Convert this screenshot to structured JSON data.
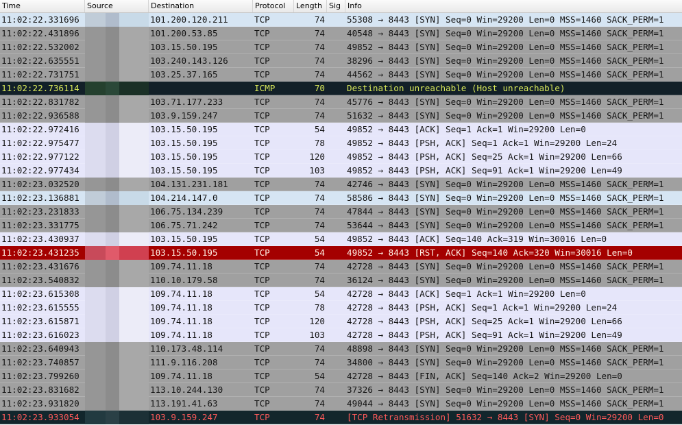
{
  "columns": {
    "time": "Time",
    "source": "Source",
    "destination": "Destination",
    "protocol": "Protocol",
    "length": "Length",
    "sig": "Sig",
    "info": "Info"
  },
  "colors": {
    "gray_row": "#a0a0a0",
    "light_row": "#e6e6fa",
    "selected_row": "#d6e5f3",
    "icmp_row": "#122028",
    "rst_row": "#a40000",
    "retransmission_row": "#12262c"
  },
  "packets": [
    {
      "time": "11:02:22.331696",
      "destination": "101.200.120.211",
      "protocol": "TCP",
      "length": "74",
      "info": "55308 → 8443 [SYN] Seq=0 Win=29200 Len=0 MSS=1460 SACK_PERM=1",
      "style": "sel"
    },
    {
      "time": "11:02:22.431896",
      "destination": "101.200.53.85",
      "protocol": "TCP",
      "length": "74",
      "info": "40548 → 8443 [SYN] Seq=0 Win=29200 Len=0 MSS=1460 SACK_PERM=1",
      "style": "gray"
    },
    {
      "time": "11:02:22.532002",
      "destination": "103.15.50.195",
      "protocol": "TCP",
      "length": "74",
      "info": "49852 → 8443 [SYN] Seq=0 Win=29200 Len=0 MSS=1460 SACK_PERM=1",
      "style": "gray"
    },
    {
      "time": "11:02:22.635551",
      "destination": "103.240.143.126",
      "protocol": "TCP",
      "length": "74",
      "info": "38296 → 8443 [SYN] Seq=0 Win=29200 Len=0 MSS=1460 SACK_PERM=1",
      "style": "gray"
    },
    {
      "time": "11:02:22.731751",
      "destination": "103.25.37.165",
      "protocol": "TCP",
      "length": "74",
      "info": "44562 → 8443 [SYN] Seq=0 Win=29200 Len=0 MSS=1460 SACK_PERM=1",
      "style": "gray"
    },
    {
      "time": "11:02:22.736114",
      "destination": "",
      "protocol": "ICMP",
      "length": "70",
      "info": "Destination unreachable (Host unreachable)",
      "style": "icmp"
    },
    {
      "time": "11:02:22.831782",
      "destination": "103.71.177.233",
      "protocol": "TCP",
      "length": "74",
      "info": "45776 → 8443 [SYN] Seq=0 Win=29200 Len=0 MSS=1460 SACK_PERM=1",
      "style": "gray"
    },
    {
      "time": "11:02:22.936588",
      "destination": "103.9.159.247",
      "protocol": "TCP",
      "length": "74",
      "info": "51632 → 8443 [SYN] Seq=0 Win=29200 Len=0 MSS=1460 SACK_PERM=1",
      "style": "gray"
    },
    {
      "time": "11:02:22.972416",
      "destination": "103.15.50.195",
      "protocol": "TCP",
      "length": "54",
      "info": "49852 → 8443 [ACK] Seq=1 Ack=1 Win=29200 Len=0",
      "style": "light"
    },
    {
      "time": "11:02:22.975477",
      "destination": "103.15.50.195",
      "protocol": "TCP",
      "length": "78",
      "info": "49852 → 8443 [PSH, ACK] Seq=1 Ack=1 Win=29200 Len=24",
      "style": "light"
    },
    {
      "time": "11:02:22.977122",
      "destination": "103.15.50.195",
      "protocol": "TCP",
      "length": "120",
      "info": "49852 → 8443 [PSH, ACK] Seq=25 Ack=1 Win=29200 Len=66",
      "style": "light"
    },
    {
      "time": "11:02:22.977434",
      "destination": "103.15.50.195",
      "protocol": "TCP",
      "length": "103",
      "info": "49852 → 8443 [PSH, ACK] Seq=91 Ack=1 Win=29200 Len=49",
      "style": "light"
    },
    {
      "time": "11:02:23.032520",
      "destination": "104.131.231.181",
      "protocol": "TCP",
      "length": "74",
      "info": "42746 → 8443 [SYN] Seq=0 Win=29200 Len=0 MSS=1460 SACK_PERM=1",
      "style": "gray"
    },
    {
      "time": "11:02:23.136881",
      "destination": "104.214.147.0",
      "protocol": "TCP",
      "length": "74",
      "info": "58586 → 8443 [SYN] Seq=0 Win=29200 Len=0 MSS=1460 SACK_PERM=1",
      "style": "sel"
    },
    {
      "time": "11:02:23.231833",
      "destination": "106.75.134.239",
      "protocol": "TCP",
      "length": "74",
      "info": "47844 → 8443 [SYN] Seq=0 Win=29200 Len=0 MSS=1460 SACK_PERM=1",
      "style": "gray"
    },
    {
      "time": "11:02:23.331775",
      "destination": "106.75.71.242",
      "protocol": "TCP",
      "length": "74",
      "info": "53644 → 8443 [SYN] Seq=0 Win=29200 Len=0 MSS=1460 SACK_PERM=1",
      "style": "gray"
    },
    {
      "time": "11:02:23.430937",
      "destination": "103.15.50.195",
      "protocol": "TCP",
      "length": "54",
      "info": "49852 → 8443 [ACK] Seq=140 Ack=319 Win=30016 Len=0",
      "style": "light"
    },
    {
      "time": "11:02:23.431235",
      "destination": "103.15.50.195",
      "protocol": "TCP",
      "length": "54",
      "info": "49852 → 8443 [RST, ACK] Seq=140 Ack=320 Win=30016 Len=0",
      "style": "rst"
    },
    {
      "time": "11:02:23.431676",
      "destination": "109.74.11.18",
      "protocol": "TCP",
      "length": "74",
      "info": "42728 → 8443 [SYN] Seq=0 Win=29200 Len=0 MSS=1460 SACK_PERM=1",
      "style": "gray"
    },
    {
      "time": "11:02:23.540832",
      "destination": "110.10.179.58",
      "protocol": "TCP",
      "length": "74",
      "info": "36124 → 8443 [SYN] Seq=0 Win=29200 Len=0 MSS=1460 SACK_PERM=1",
      "style": "gray"
    },
    {
      "time": "11:02:23.615308",
      "destination": "109.74.11.18",
      "protocol": "TCP",
      "length": "54",
      "info": "42728 → 8443 [ACK] Seq=1 Ack=1 Win=29200 Len=0",
      "style": "light"
    },
    {
      "time": "11:02:23.615555",
      "destination": "109.74.11.18",
      "protocol": "TCP",
      "length": "78",
      "info": "42728 → 8443 [PSH, ACK] Seq=1 Ack=1 Win=29200 Len=24",
      "style": "light"
    },
    {
      "time": "11:02:23.615871",
      "destination": "109.74.11.18",
      "protocol": "TCP",
      "length": "120",
      "info": "42728 → 8443 [PSH, ACK] Seq=25 Ack=1 Win=29200 Len=66",
      "style": "light"
    },
    {
      "time": "11:02:23.616023",
      "destination": "109.74.11.18",
      "protocol": "TCP",
      "length": "103",
      "info": "42728 → 8443 [PSH, ACK] Seq=91 Ack=1 Win=29200 Len=49",
      "style": "light"
    },
    {
      "time": "11:02:23.640943",
      "destination": "110.173.48.114",
      "protocol": "TCP",
      "length": "74",
      "info": "48898 → 8443 [SYN] Seq=0 Win=29200 Len=0 MSS=1460 SACK_PERM=1",
      "style": "gray"
    },
    {
      "time": "11:02:23.740857",
      "destination": "111.9.116.208",
      "protocol": "TCP",
      "length": "74",
      "info": "34800 → 8443 [SYN] Seq=0 Win=29200 Len=0 MSS=1460 SACK_PERM=1",
      "style": "gray"
    },
    {
      "time": "11:02:23.799260",
      "destination": "109.74.11.18",
      "protocol": "TCP",
      "length": "54",
      "info": "42728 → 8443 [FIN, ACK] Seq=140 Ack=2 Win=29200 Len=0",
      "style": "gray"
    },
    {
      "time": "11:02:23.831682",
      "destination": "113.10.244.130",
      "protocol": "TCP",
      "length": "74",
      "info": "37326 → 8443 [SYN] Seq=0 Win=29200 Len=0 MSS=1460 SACK_PERM=1",
      "style": "gray"
    },
    {
      "time": "11:02:23.931820",
      "destination": "113.191.41.63",
      "protocol": "TCP",
      "length": "74",
      "info": "49044 → 8443 [SYN] Seq=0 Win=29200 Len=0 MSS=1460 SACK_PERM=1",
      "style": "gray"
    },
    {
      "time": "11:02:23.933054",
      "destination": "103.9.159.247",
      "protocol": "TCP",
      "length": "74",
      "info": "[TCP Retransmission] 51632 → 8443 [SYN] Seq=0 Win=29200 Len=0",
      "style": "retx"
    }
  ]
}
